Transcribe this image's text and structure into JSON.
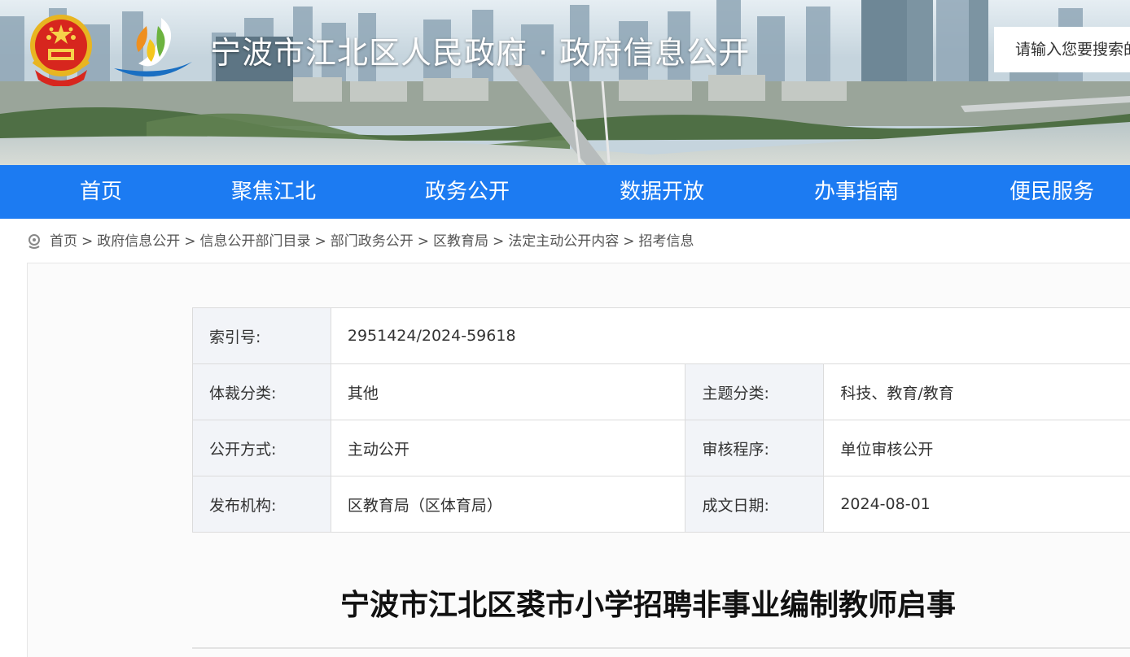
{
  "header": {
    "site_title": "宁波市江北区人民政府 · 政府信息公开",
    "search_placeholder": "请输入您要搜索的内容"
  },
  "nav": {
    "items": [
      "首页",
      "聚焦江北",
      "政务公开",
      "数据开放",
      "办事指南",
      "便民服务"
    ]
  },
  "breadcrumb": {
    "items": [
      "首页",
      "政府信息公开",
      "信息公开部门目录",
      "部门政务公开",
      "区教育局",
      "法定主动公开内容",
      "招考信息"
    ],
    "separator": ">"
  },
  "meta": {
    "index_label": "索引号:",
    "index_value": "2951424/2024-59618",
    "genre_label": "体裁分类:",
    "genre_value": "其他",
    "topic_label": "主题分类:",
    "topic_value": "科技、教育/教育",
    "method_label": "公开方式:",
    "method_value": "主动公开",
    "review_label": "审核程序:",
    "review_value": "单位审核公开",
    "publisher_label": "发布机构:",
    "publisher_value": "区教育局（区体育局）",
    "date_label": "成文日期:",
    "date_value": "2024-08-01"
  },
  "article": {
    "title": "宁波市江北区裘市小学招聘非事业编制教师启事"
  },
  "colors": {
    "nav_bg": "#1c7bf2",
    "meta_key_bg": "#f2f4f8"
  }
}
